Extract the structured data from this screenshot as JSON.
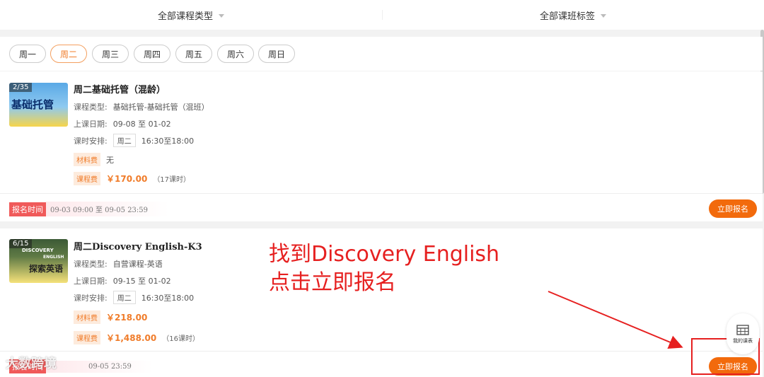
{
  "filters": {
    "type_label": "全部课程类型",
    "tag_label": "全部课班标签"
  },
  "weekdays": [
    "周一",
    "周二",
    "周三",
    "周四",
    "周五",
    "周六",
    "周日"
  ],
  "selected_day_index": 1,
  "courses": [
    {
      "count": "2/35",
      "thumb_text": "基础托管",
      "title": "周二基础托管（混龄）",
      "type_label": "课程类型:",
      "type_value": "基础托管-基础托管（混班）",
      "date_label": "上课日期:",
      "date_value": "09-08 至 01-02",
      "schedule_label": "课时安排:",
      "schedule_day": "周二",
      "schedule_time": "16:30至18:00",
      "material_label": "材料费",
      "material_value": "无",
      "fee_label": "课程费",
      "fee_value": "￥170.00",
      "fee_hours": "（17课时）",
      "reg_label": "报名时间",
      "reg_range": "09-03 09:00 至 09-05 23:59",
      "button": "立即报名"
    },
    {
      "count": "6/15",
      "thumb_text": "探索英语",
      "thumb_small": "DISCOVERY",
      "thumb_small2": "ENGLISH",
      "title": "周二Discovery English-K3",
      "type_label": "课程类型:",
      "type_value": "自营课程-英语",
      "date_label": "上课日期:",
      "date_value": "09-15 至 01-02",
      "schedule_label": "课时安排:",
      "schedule_day": "周二",
      "schedule_time": "16:30至18:00",
      "material_label": "材料费",
      "material_value": "￥218.00",
      "fee_label": "课程费",
      "fee_value": "￥1,488.00",
      "fee_hours": "（16课时）",
      "reg_label": "报名时间",
      "reg_range": "09-05 23:59",
      "button": "立即报名"
    }
  ],
  "annotation": {
    "line1": "找到Discovery English",
    "line2": "点击立即报名"
  },
  "fab": {
    "label": "我的课表",
    "icon": "calendar-icon"
  },
  "watermark": "大数跨境",
  "colors": {
    "accent": "#f26a0c",
    "annotation": "#e62020"
  }
}
